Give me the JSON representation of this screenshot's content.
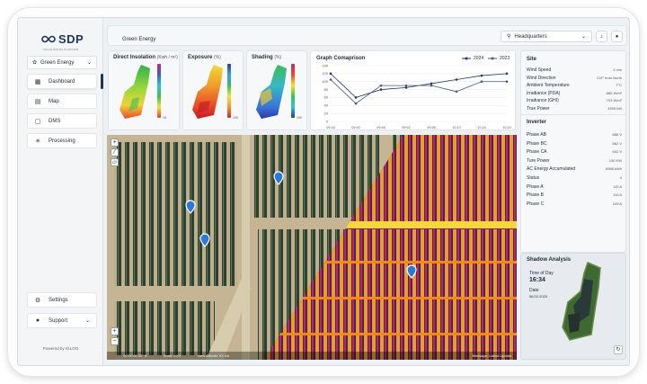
{
  "brand": {
    "name": "SDP",
    "tagline": "SOLAR DIGITAL PLATFORM"
  },
  "sidebar": {
    "project": "Green Energy",
    "nav": [
      {
        "label": "Dashboard",
        "icon": "dashboard-icon"
      },
      {
        "label": "Map",
        "icon": "map-icon"
      },
      {
        "label": "DMS",
        "icon": "dms-icon"
      },
      {
        "label": "Processing",
        "icon": "processing-icon"
      }
    ],
    "settings": "Settings",
    "support": "Support",
    "powered": "Powered by IGLOO"
  },
  "header": {
    "title": "Green Energy",
    "location": "Headquarters"
  },
  "cards": {
    "insolation": {
      "title": "Direct Insolation",
      "unit": "(Kwh / m²)",
      "ticks": [
        "",
        "",
        "",
        "",
        "",
        "15"
      ]
    },
    "exposure": {
      "title": "Exposure",
      "unit": "(%)",
      "ticks": [
        "",
        "",
        "",
        "",
        "",
        "100"
      ]
    },
    "shading": {
      "title": "Shading",
      "unit": "(%)",
      "ticks": [
        "",
        "",
        "",
        "",
        "",
        "100"
      ]
    }
  },
  "chart_data": {
    "type": "line",
    "title": "Graph Comaprison",
    "x": [
      "09:34",
      "09:40",
      "09:46",
      "09:52",
      "09:58",
      "10:10",
      "10:16",
      "10:22"
    ],
    "ylim": [
      0,
      140
    ],
    "yticks": [
      0,
      20,
      40,
      60,
      80,
      100,
      120,
      140
    ],
    "series": [
      {
        "name": "2024",
        "values": [
          120,
          60,
          80,
          85,
          95,
          105,
          115,
          120
        ],
        "color": "#1d3a6e"
      },
      {
        "name": "2023",
        "values": [
          105,
          45,
          90,
          90,
          90,
          75,
          100,
          100
        ],
        "color": "#4a5a70"
      }
    ],
    "grid": true,
    "legend": "top-right"
  },
  "site": {
    "title": "Site",
    "rows": [
      {
        "label": "Wind Speed",
        "value": "2 m/s"
      },
      {
        "label": "Wind Direction",
        "value": "213° from North"
      },
      {
        "label": "Ambient Temperature",
        "value": "7°C"
      },
      {
        "label": "Irradiance (PDA)",
        "value": "880 W/m²"
      },
      {
        "label": "Irradiance (GHI)",
        "value": "703 W/m²"
      },
      {
        "label": "True Power",
        "value": "4395 kW"
      }
    ]
  },
  "inverter": {
    "title": "Inverter",
    "rows": [
      {
        "label": "Phase AB",
        "value": "686 V"
      },
      {
        "label": "Phase BC",
        "value": "682 V"
      },
      {
        "label": "Phase CA",
        "value": "692 V"
      },
      {
        "label": "Ture Power",
        "value": "130 KW"
      },
      {
        "label": "AC Energy Accumulated",
        "value": "6988 kWh"
      },
      {
        "label": "Status",
        "value": "4"
      },
      {
        "label": "Phase A",
        "value": "110 A"
      },
      {
        "label": "Phase B",
        "value": "110 A"
      },
      {
        "label": "Phase C",
        "value": "109 A"
      }
    ]
  },
  "shadow": {
    "title": "Shadow Analysis",
    "time_label": "Time of Day",
    "time": "16:34",
    "date_label": "Date",
    "date": "06.02.2023"
  },
  "map": {
    "coords": "30°00'00.00\" N",
    "scale": "Scale 1:XX",
    "view": "View Altitude XX km",
    "update": "Message: Latest Update"
  }
}
